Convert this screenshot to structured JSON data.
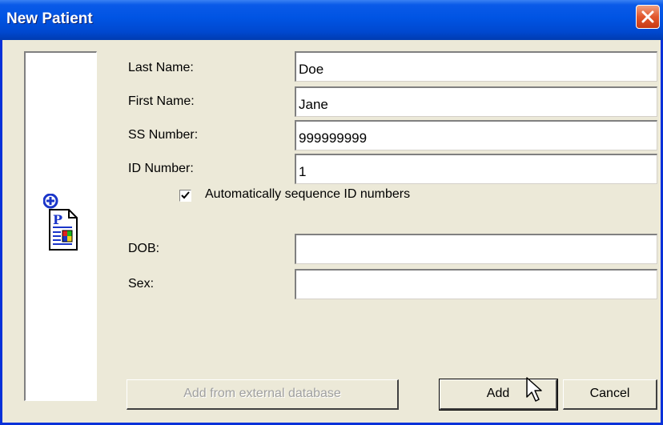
{
  "window": {
    "title": "New Patient"
  },
  "form": {
    "last_name": {
      "label": "Last Name:",
      "value": "Doe"
    },
    "first_name": {
      "label": "First Name:",
      "value": "Jane"
    },
    "ss_number": {
      "label": "SS Number:",
      "value": "999999999"
    },
    "id_number": {
      "label": "ID Number:",
      "value": "1"
    },
    "auto_sequence": {
      "label": "Automatically sequence ID numbers",
      "checked": true
    },
    "dob": {
      "label": "DOB:",
      "value": ""
    },
    "sex": {
      "label": "Sex:",
      "value": ""
    }
  },
  "buttons": {
    "add_external": "Add from external database",
    "add": "Add",
    "cancel": "Cancel"
  },
  "icons": {
    "close": "close-icon",
    "patient": "new-patient-icon",
    "cursor": "mouse-pointer-icon"
  }
}
